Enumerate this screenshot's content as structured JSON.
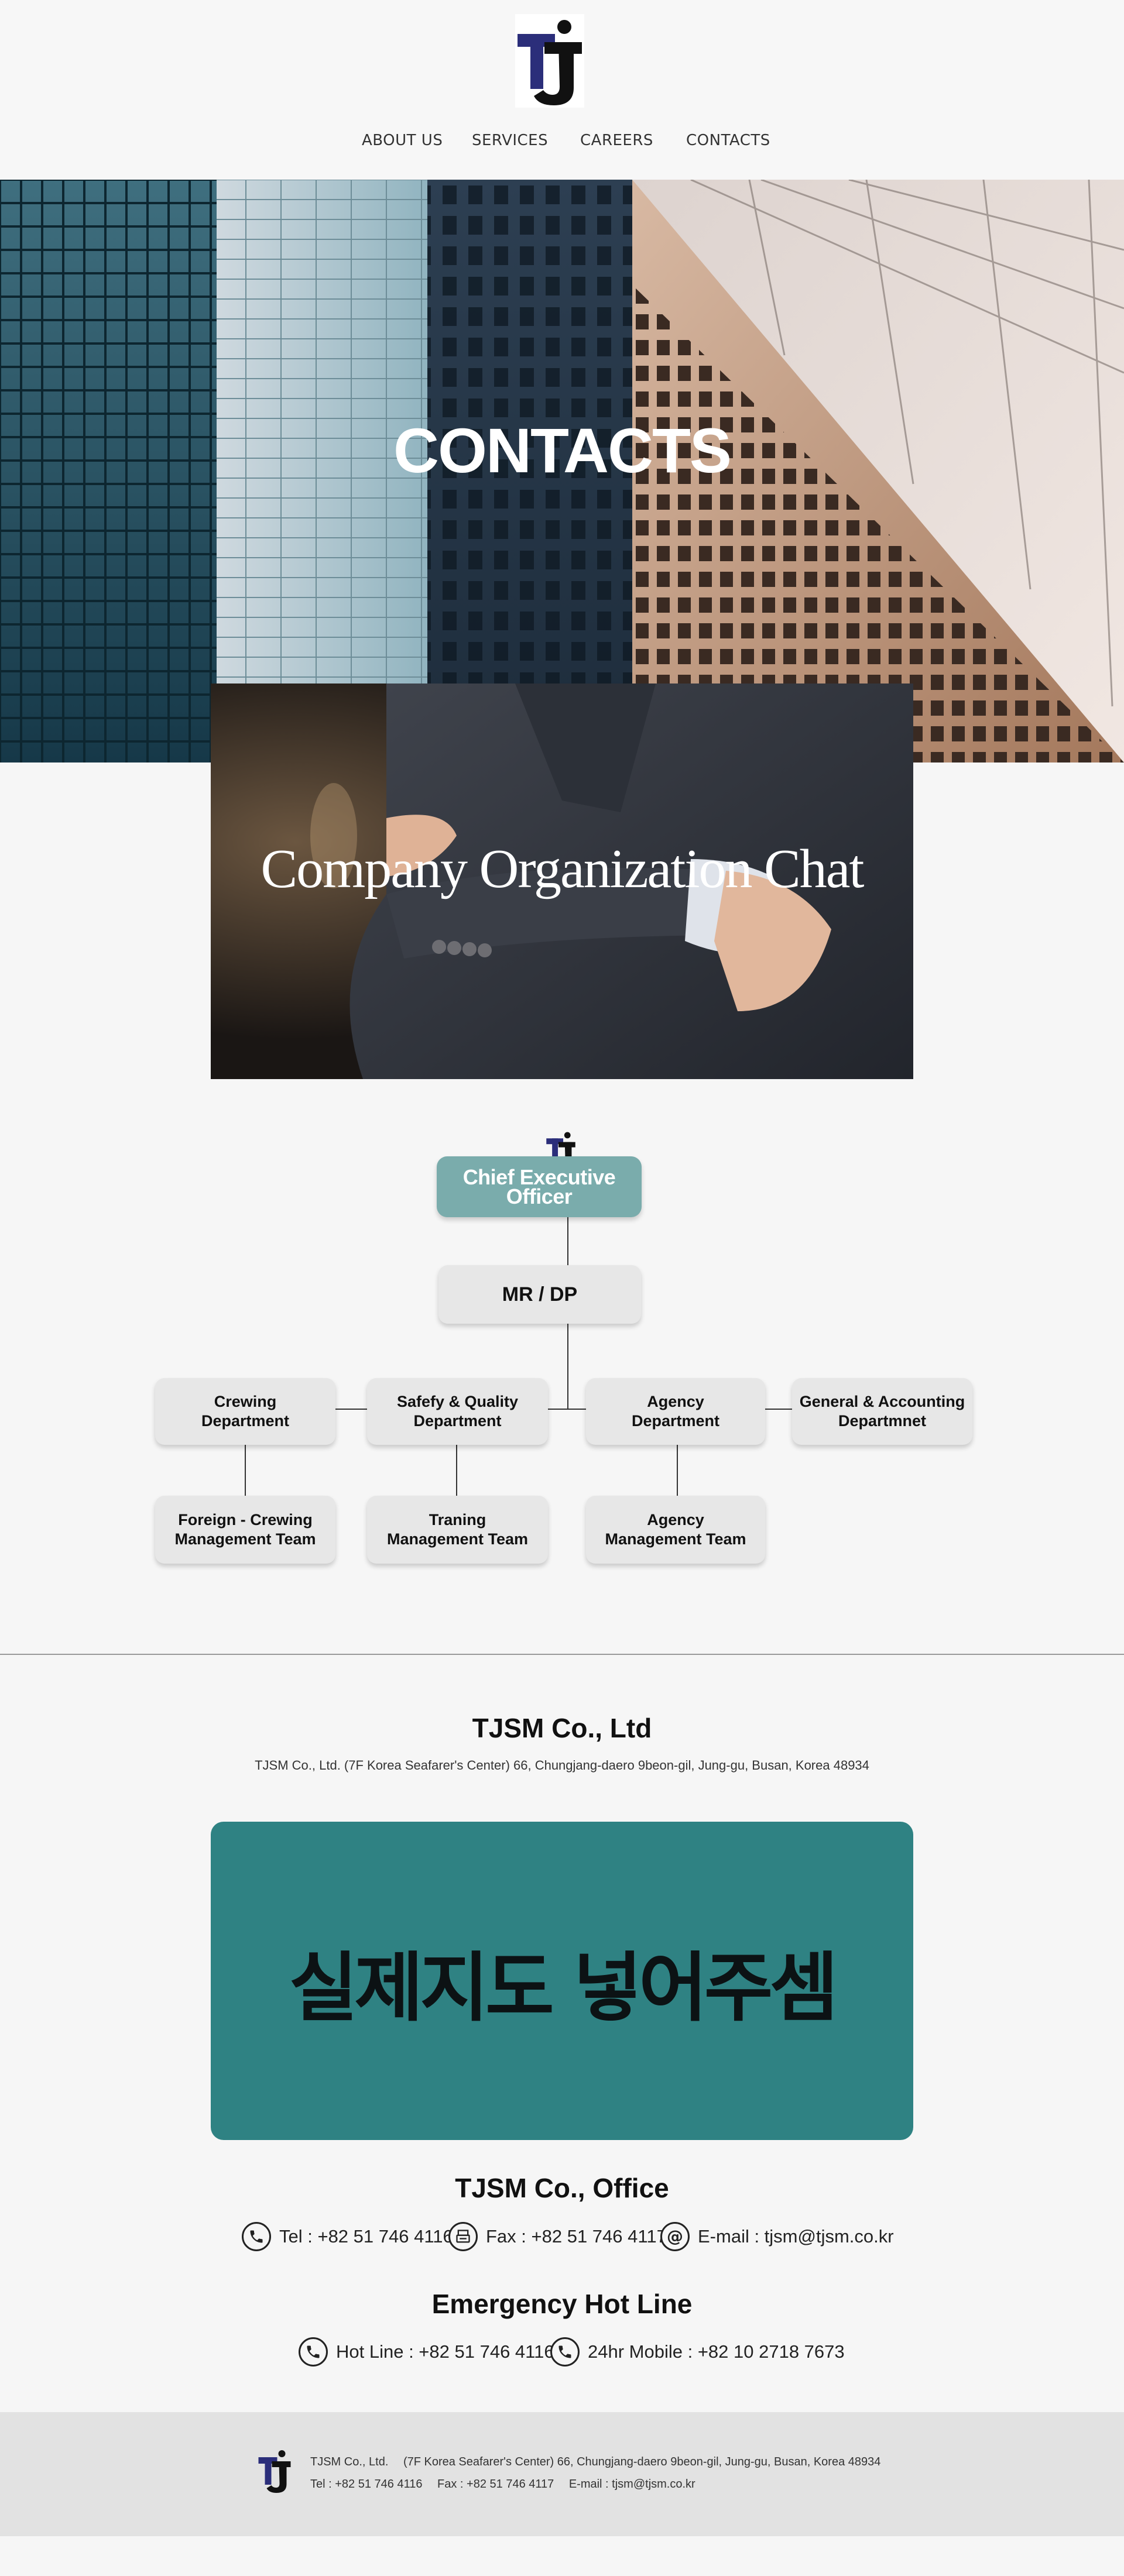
{
  "nav": {
    "items": [
      "ABOUT US",
      "SERVICES",
      "CAREERS",
      "CONTACTS"
    ]
  },
  "hero": {
    "title": "CONTACTS"
  },
  "org_banner": {
    "title": "Company Organization Chat"
  },
  "org_chart": {
    "ceo": "Chief Executive Officer",
    "mr": "MR / DP",
    "departments": [
      "Crewing\nDepartment",
      "Safefy & Quality\nDepartment",
      "Agency\nDepartment",
      "General & Accounting\nDepartmnet"
    ],
    "teams": [
      "Foreign - Crewing\nManagement Team",
      "Traning\nManagement Team",
      "Agency\nManagement Team"
    ]
  },
  "company": {
    "title": "TJSM Co., Ltd",
    "address": "TJSM Co., Ltd.    (7F Korea Seafarer's Center) 66, Chungjang-daero 9beon-gil, Jung-gu, Busan, Korea 48934",
    "map_placeholder": "실제지도 넣어주셈"
  },
  "office": {
    "title": "TJSM Co., Office",
    "tel": "Tel : +82 51 746 4116",
    "fax": "Fax : +82 51 746 4117",
    "email": "E-mail : tjsm@tjsm.co.kr"
  },
  "hotline": {
    "title": "Emergency Hot Line",
    "line": "Hot Line : +82 51 746 4116",
    "mobile": "24hr Mobile : +82 10 2718 7673"
  },
  "footer": {
    "company": "TJSM Co., Ltd.",
    "address": "(7F Korea Seafarer's Center) 66, Chungjang-daero 9beon-gil, Jung-gu, Busan, Korea 48934",
    "tel": "Tel : +82 51 746 4116",
    "fax": "Fax : +82 51 746 4117",
    "email": "E-mail : tjsm@tjsm.co.kr"
  },
  "icons": {
    "logo": "tj-logo",
    "phone": "phone-icon",
    "fax": "fax-icon",
    "email": "at-icon"
  },
  "colors": {
    "brand_navy": "#2b2e7a",
    "ceo_box": "#7aacac",
    "map_box": "#2f8283",
    "footer_bg": "#e2e2e2"
  }
}
